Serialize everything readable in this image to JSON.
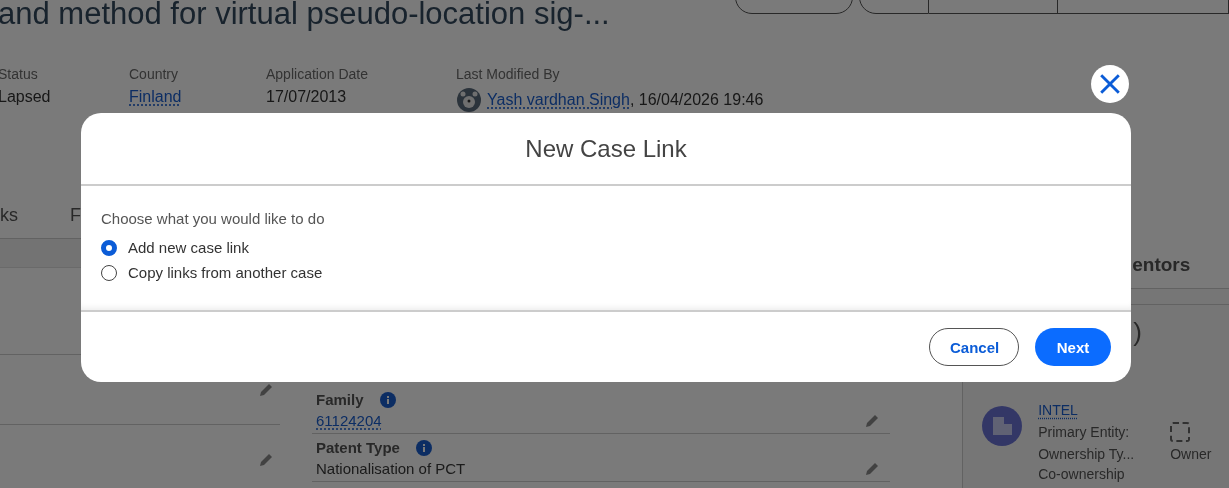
{
  "page": {
    "title": "and method for virtual pseudo-location sig-...",
    "summary": [
      {
        "label": "Status",
        "value": "Lapsed",
        "kind": "text"
      },
      {
        "label": "Country",
        "value": "Finland",
        "kind": "link"
      },
      {
        "label": "Application Date",
        "value": "17/07/2013",
        "kind": "text"
      },
      {
        "label": "Last Modified By",
        "value": "Yash vardhan Singh",
        "kind": "user",
        "suffix": ", 16/04/2026 19:46"
      }
    ],
    "tabs": [
      {
        "label": "ks"
      },
      {
        "label": "F"
      }
    ],
    "details": [
      {
        "label": "Family",
        "value": "61124204",
        "kind": "link"
      },
      {
        "label": "Patent Type",
        "value": "Nationalisation of PCT",
        "kind": "text"
      }
    ],
    "side_panel": {
      "title": "entors",
      "count_fragment": ")",
      "owner": {
        "name": "INTEL",
        "rows": [
          {
            "label": "Primary Entity:",
            "kind": "checkbox",
            "checked": false
          },
          {
            "label": "Ownership Ty...",
            "value": "Owner",
            "kind": "text"
          },
          {
            "label": "Co-ownership",
            "kind": "text"
          }
        ]
      }
    }
  },
  "modal": {
    "title": "New Case Link",
    "prompt": "Choose what you would like to do",
    "options": [
      {
        "label": "Add new case link",
        "selected": true
      },
      {
        "label": "Copy links from another case",
        "selected": false
      }
    ],
    "buttons": [
      {
        "label": "Cancel",
        "kind": "secondary"
      },
      {
        "label": "Next",
        "kind": "primary"
      }
    ]
  }
}
